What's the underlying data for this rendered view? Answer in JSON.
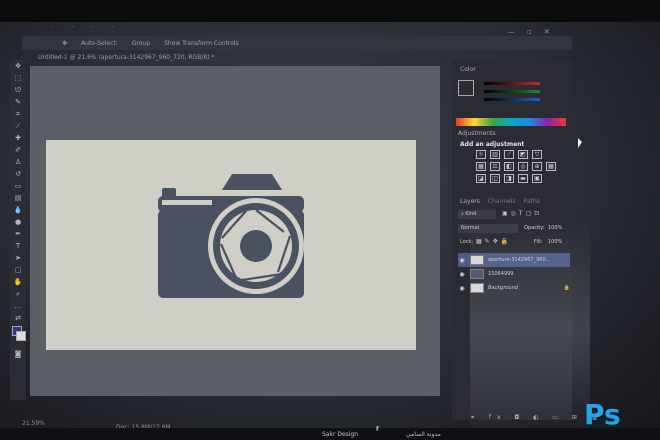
{
  "options_bar": {
    "auto_select": "Auto-Select:",
    "group": "Group",
    "transform": "Show Transform Controls"
  },
  "document_tab": "Untitled-1 @ 21.6% (apertura-3142967_960_720, RGB/8) *",
  "status": {
    "zoom": "21.59%",
    "doc": "Doc: 15.8M/17.8M"
  },
  "panels": {
    "color": "Color",
    "adjustments": "Adjustments",
    "add_adjustment": "Add an adjustment",
    "layers_tab": "Layers",
    "channels_tab": "Channels",
    "paths_tab": "Paths",
    "kind": "Kind",
    "blend_mode": "Normal",
    "opacity_label": "Opacity:",
    "opacity_value": "100%",
    "lock_label": "Lock:",
    "fill_label": "Fill:",
    "fill_value": "100%"
  },
  "layers": [
    {
      "name": "aperture-3142967_960...",
      "selected": true
    },
    {
      "name": "15064999",
      "selected": false
    },
    {
      "name": "Background",
      "selected": false
    }
  ],
  "bottom": {
    "brand": "Sakr Design",
    "arabic": "مدونة الصامي"
  },
  "app_logo": "Ps",
  "colors": {
    "accent": "#1fa6e8",
    "camera": "#4a5160",
    "document_bg": "#cfcfc7"
  }
}
